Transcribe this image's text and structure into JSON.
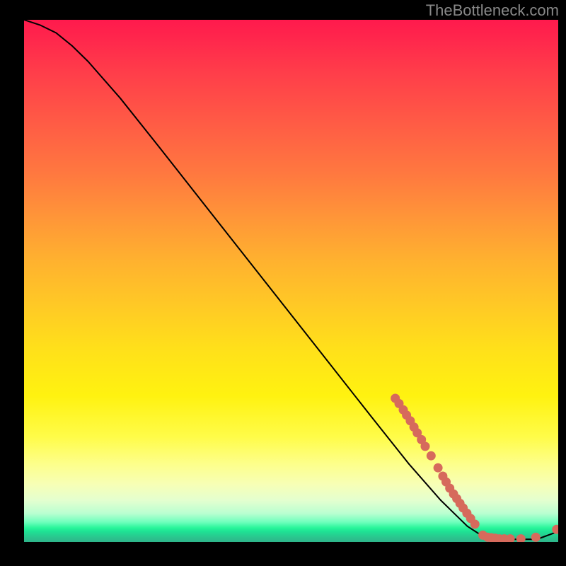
{
  "watermark": "TheBottleneck.com",
  "chart_data": {
    "type": "line",
    "title": "",
    "xlabel": "",
    "ylabel": "",
    "xlim": [
      0,
      100
    ],
    "ylim": [
      0,
      100
    ],
    "grid": false,
    "legend": false,
    "curve": [
      {
        "x": 0,
        "y": 100
      },
      {
        "x": 3,
        "y": 99
      },
      {
        "x": 6,
        "y": 97.5
      },
      {
        "x": 9,
        "y": 95
      },
      {
        "x": 12,
        "y": 92
      },
      {
        "x": 18,
        "y": 85
      },
      {
        "x": 25,
        "y": 76
      },
      {
        "x": 35,
        "y": 63
      },
      {
        "x": 45,
        "y": 50
      },
      {
        "x": 55,
        "y": 37
      },
      {
        "x": 65,
        "y": 24
      },
      {
        "x": 72,
        "y": 15
      },
      {
        "x": 78,
        "y": 8
      },
      {
        "x": 83,
        "y": 3
      },
      {
        "x": 86,
        "y": 1
      },
      {
        "x": 88,
        "y": 0.5
      },
      {
        "x": 92,
        "y": 0.5
      },
      {
        "x": 96,
        "y": 0.5
      },
      {
        "x": 100,
        "y": 2
      }
    ],
    "points": [
      {
        "x": 69.5,
        "y": 27.5
      },
      {
        "x": 70.2,
        "y": 26.5
      },
      {
        "x": 71.0,
        "y": 25.3
      },
      {
        "x": 71.6,
        "y": 24.3
      },
      {
        "x": 72.3,
        "y": 23.2
      },
      {
        "x": 73.0,
        "y": 22.0
      },
      {
        "x": 73.6,
        "y": 20.9
      },
      {
        "x": 74.4,
        "y": 19.6
      },
      {
        "x": 75.1,
        "y": 18.3
      },
      {
        "x": 76.2,
        "y": 16.5
      },
      {
        "x": 77.5,
        "y": 14.2
      },
      {
        "x": 78.4,
        "y": 12.6
      },
      {
        "x": 79.0,
        "y": 11.5
      },
      {
        "x": 79.7,
        "y": 10.3
      },
      {
        "x": 80.4,
        "y": 9.2
      },
      {
        "x": 81.0,
        "y": 8.3
      },
      {
        "x": 81.6,
        "y": 7.4
      },
      {
        "x": 82.2,
        "y": 6.5
      },
      {
        "x": 82.9,
        "y": 5.5
      },
      {
        "x": 83.6,
        "y": 4.5
      },
      {
        "x": 84.4,
        "y": 3.4
      },
      {
        "x": 85.9,
        "y": 1.3
      },
      {
        "x": 86.8,
        "y": 0.9
      },
      {
        "x": 87.5,
        "y": 0.8
      },
      {
        "x": 88.2,
        "y": 0.7
      },
      {
        "x": 89.0,
        "y": 0.6
      },
      {
        "x": 89.9,
        "y": 0.6
      },
      {
        "x": 91.0,
        "y": 0.6
      },
      {
        "x": 93.0,
        "y": 0.6
      },
      {
        "x": 95.8,
        "y": 0.9
      },
      {
        "x": 99.7,
        "y": 2.4
      }
    ],
    "colors": {
      "gradient_top": "#ff1a4d",
      "gradient_mid": "#ffe01a",
      "gradient_bottom": "#2eb48a",
      "curve": "#000000",
      "points": "#d66a5c",
      "frame": "#000000"
    }
  }
}
